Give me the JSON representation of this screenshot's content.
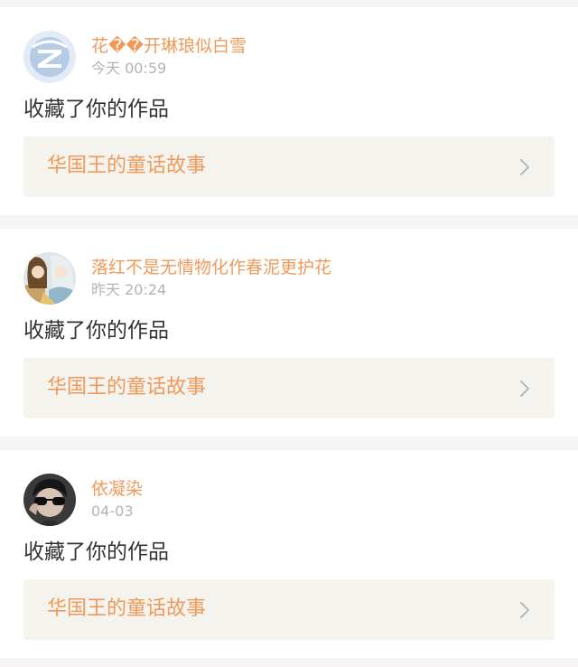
{
  "notifications": [
    {
      "user": {
        "name": "花��开琳琅似白雪",
        "avatar": "qq-default-avatar"
      },
      "time": "今天 00:59",
      "action": "收藏了你的作品",
      "work": {
        "title": "华国王的童话故事"
      }
    },
    {
      "user": {
        "name": "落红不是无情物化作春泥更护花",
        "avatar": "anime-characters-avatar"
      },
      "time": "昨天 20:24",
      "action": "收藏了你的作品",
      "work": {
        "title": "华国王的童话故事"
      }
    },
    {
      "user": {
        "name": "依凝染",
        "avatar": "person-with-sunglasses-avatar"
      },
      "time": "04-03",
      "action": "收藏了你的作品",
      "work": {
        "title": "华国王的童话故事"
      }
    }
  ],
  "icons": {
    "work_link": "chevron-right-icon"
  },
  "colors": {
    "accent": "#ef9a5a",
    "text": "#333333",
    "muted": "#b3b3b3",
    "work_bg": "#f4f3ee",
    "page_bg": "#f6f4f4"
  }
}
